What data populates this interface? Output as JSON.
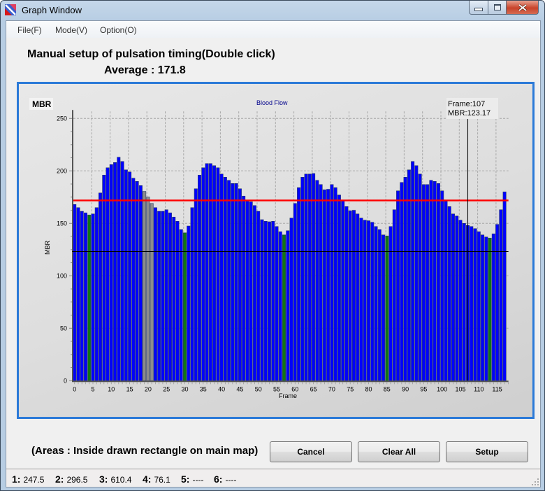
{
  "window": {
    "title": "Graph Window",
    "icon": "app-icon",
    "controls": [
      "minimize-icon",
      "maximize-icon",
      "close-icon"
    ]
  },
  "menu": {
    "items": [
      {
        "label": "File(F)"
      },
      {
        "label": "Mode(V)"
      },
      {
        "label": "Option(O)"
      }
    ]
  },
  "header": {
    "instruction": "Manual setup of pulsation timing(Double click)",
    "average_label": "Average : 171.8"
  },
  "chart_data": {
    "type": "bar",
    "title": "Blood Flow",
    "panel_label": "MBR",
    "xlabel": "Frame",
    "ylabel": "MBR",
    "ylim": [
      0,
      250
    ],
    "xlim": [
      0,
      118
    ],
    "yticks": [
      0,
      50,
      100,
      150,
      200,
      250
    ],
    "xticks": [
      0,
      5,
      10,
      15,
      20,
      25,
      30,
      35,
      40,
      45,
      50,
      55,
      60,
      65,
      70,
      75,
      80,
      85,
      90,
      95,
      100,
      105,
      110,
      115
    ],
    "grid": true,
    "x": [
      0,
      1,
      2,
      3,
      4,
      5,
      6,
      7,
      8,
      9,
      10,
      11,
      12,
      13,
      14,
      15,
      16,
      17,
      18,
      19,
      20,
      21,
      22,
      23,
      24,
      25,
      26,
      27,
      28,
      29,
      30,
      31,
      32,
      33,
      34,
      35,
      36,
      37,
      38,
      39,
      40,
      41,
      42,
      43,
      44,
      45,
      46,
      47,
      48,
      49,
      50,
      51,
      52,
      53,
      54,
      55,
      56,
      57,
      58,
      59,
      60,
      61,
      62,
      63,
      64,
      65,
      66,
      67,
      68,
      69,
      70,
      71,
      72,
      73,
      74,
      75,
      76,
      77,
      78,
      79,
      80,
      81,
      82,
      83,
      84,
      85,
      86,
      87,
      88,
      89,
      90,
      91,
      92,
      93,
      94,
      95,
      96,
      97,
      98,
      99,
      100,
      101,
      102,
      103,
      104,
      105,
      106,
      107,
      108,
      109,
      110,
      111,
      112,
      113,
      114,
      115,
      116,
      117
    ],
    "values": [
      168,
      165,
      161.5,
      160,
      158,
      159,
      165,
      179,
      196,
      203,
      206,
      208,
      213,
      209,
      201,
      199,
      193,
      190,
      186,
      180.5,
      175,
      169,
      165,
      161.5,
      161.5,
      163,
      160,
      156,
      152,
      144,
      141,
      147.5,
      165,
      183,
      196,
      203,
      207,
      207,
      205,
      203,
      197,
      194,
      191,
      188,
      188,
      183,
      176,
      171,
      170.5,
      167,
      161.5,
      153.5,
      152,
      151.5,
      152,
      147,
      142,
      139,
      143,
      155,
      169,
      184,
      194,
      197,
      197,
      197.5,
      191,
      187,
      182,
      182.5,
      187,
      184,
      177,
      172,
      166,
      162,
      162.5,
      159,
      155,
      153,
      152.5,
      151,
      147,
      144,
      139,
      138,
      147,
      163,
      181,
      189,
      194,
      201,
      209,
      205,
      197,
      187,
      187,
      191,
      190,
      188,
      181,
      171,
      166,
      159,
      157,
      153,
      150,
      148,
      147,
      145,
      142,
      139,
      137,
      136,
      140,
      149,
      163,
      180
    ],
    "series_colors": {
      "normal": "#0000ff",
      "selected": "#8c8c8c",
      "pulse_marker": "#117711"
    },
    "selected_frames": [
      19,
      20,
      21
    ],
    "pulse_frames": [
      4,
      30,
      57,
      85,
      113
    ],
    "average_line": {
      "value": 171.8,
      "color": "#ff0000"
    },
    "cursor": {
      "frame": 107,
      "mbr": 123.17,
      "frame_label": "Frame:107",
      "mbr_label": "MBR:123.17"
    }
  },
  "footer": {
    "areas_note": "(Areas :  Inside drawn rectangle on main map)",
    "buttons": {
      "cancel": "Cancel",
      "clear_all": "Clear All",
      "setup": "Setup"
    }
  },
  "status": {
    "items": [
      {
        "key": "1:",
        "value": "247.5"
      },
      {
        "key": "2:",
        "value": "296.5"
      },
      {
        "key": "3:",
        "value": "610.4"
      },
      {
        "key": "4:",
        "value": "76.1"
      },
      {
        "key": "5:",
        "value": "----"
      },
      {
        "key": "6:",
        "value": "----"
      }
    ]
  }
}
